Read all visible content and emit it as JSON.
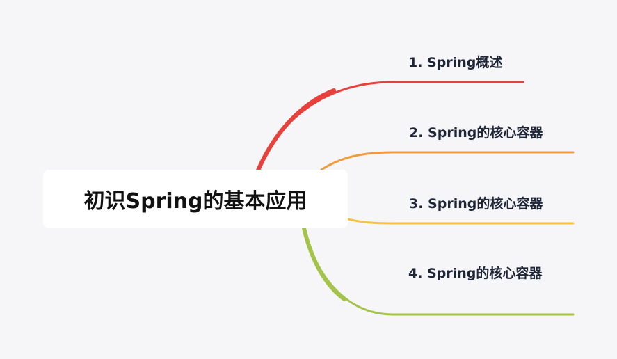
{
  "mindmap": {
    "root": {
      "label": "初识Spring的基本应用"
    },
    "topics": [
      {
        "label": "1. Spring概述",
        "color": "#e8403a"
      },
      {
        "label": "2. Spring的核心容器",
        "color": "#f19a3b"
      },
      {
        "label": "3. Spring的核心容器",
        "color": "#f4c340"
      },
      {
        "label": "4. Spring的核心容器",
        "color": "#a4c34a"
      }
    ],
    "background": "#f6f6f8"
  }
}
